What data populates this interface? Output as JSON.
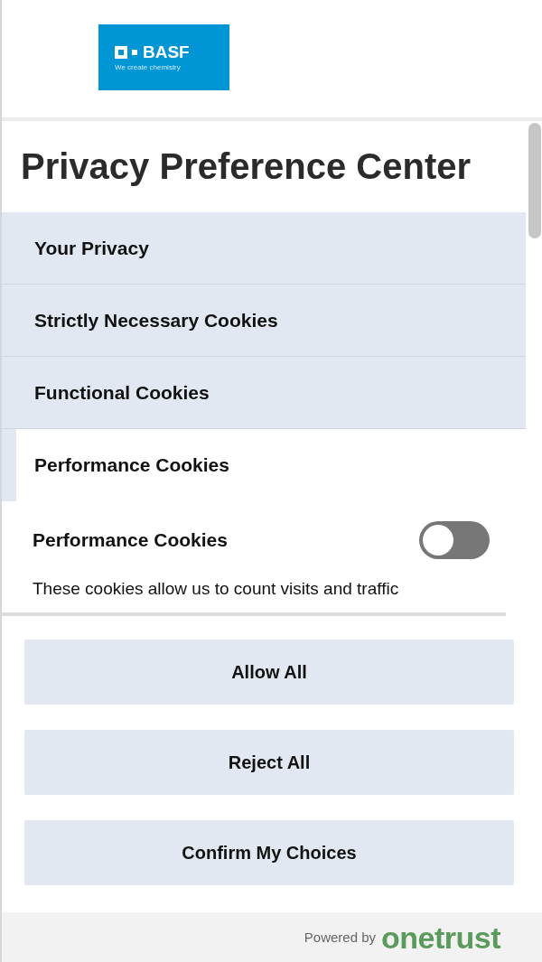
{
  "logo": {
    "wordmark": "BASF",
    "tagline": "We create chemistry"
  },
  "title": "Privacy Preference Center",
  "tabs": [
    {
      "label": "Your Privacy",
      "selected": false
    },
    {
      "label": "Strictly Necessary Cookies",
      "selected": false
    },
    {
      "label": "Functional Cookies",
      "selected": false
    },
    {
      "label": "Performance Cookies",
      "selected": true
    }
  ],
  "section": {
    "heading": "Performance Cookies",
    "on": false,
    "description": "These cookies allow us to count visits and traffic"
  },
  "buttons": [
    "Allow All",
    "Reject All",
    "Confirm My Choices"
  ],
  "footer": {
    "powered_by": "Powered by",
    "brand": "onetrust"
  }
}
